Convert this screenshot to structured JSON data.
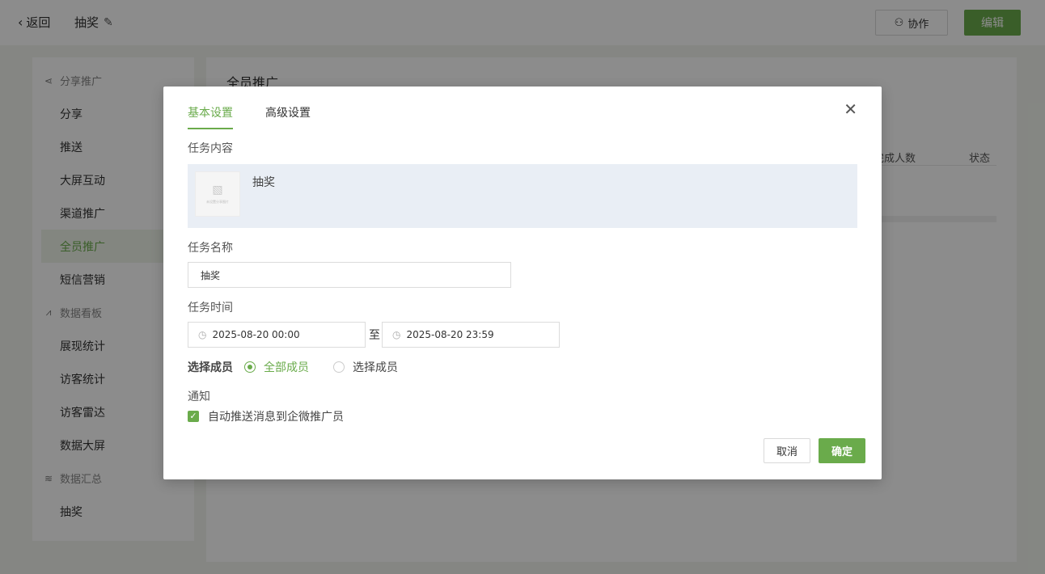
{
  "header": {
    "back_label": "返回",
    "page_name": "抽奖",
    "collab_label": "协作",
    "edit_label": "编辑"
  },
  "sidebar": {
    "groups": [
      {
        "label": "分享推广",
        "icon": "share-icon",
        "items": [
          "分享",
          "推送",
          "大屏互动",
          "渠道推广",
          "全员推广",
          "短信营销"
        ]
      },
      {
        "label": "数据看板",
        "icon": "line-chart-icon",
        "items": [
          "展现统计",
          "访客统计",
          "访客雷达",
          "数据大屏"
        ]
      },
      {
        "label": "数据汇总",
        "icon": "database-icon",
        "items": [
          "抽奖"
        ]
      }
    ],
    "active_item": "全员推广"
  },
  "content": {
    "title": "全员推广",
    "columns": [
      "完成人数",
      "状态"
    ]
  },
  "modal": {
    "tabs": [
      "基本设置",
      "高级设置"
    ],
    "active_tab": "基本设置",
    "task_content_label": "任务内容",
    "task_item": {
      "thumb_text": "未设置分享图片",
      "name": "抽奖"
    },
    "task_name_label": "任务名称",
    "task_name_value": "抽奖",
    "task_time_label": "任务时间",
    "start_time": "2025-08-20 00:00",
    "range_separator": "至",
    "end_time": "2025-08-20 23:59",
    "member_label": "选择成员",
    "member_options": [
      "全部成员",
      "选择成员"
    ],
    "member_selected": "全部成员",
    "notify_label": "通知",
    "notify_option": "自动推送消息到企微推广员",
    "notify_checked": true,
    "cancel_label": "取消",
    "ok_label": "确定"
  },
  "colors": {
    "accent": "#6aab4b",
    "task_bg": "#e9eef5"
  }
}
